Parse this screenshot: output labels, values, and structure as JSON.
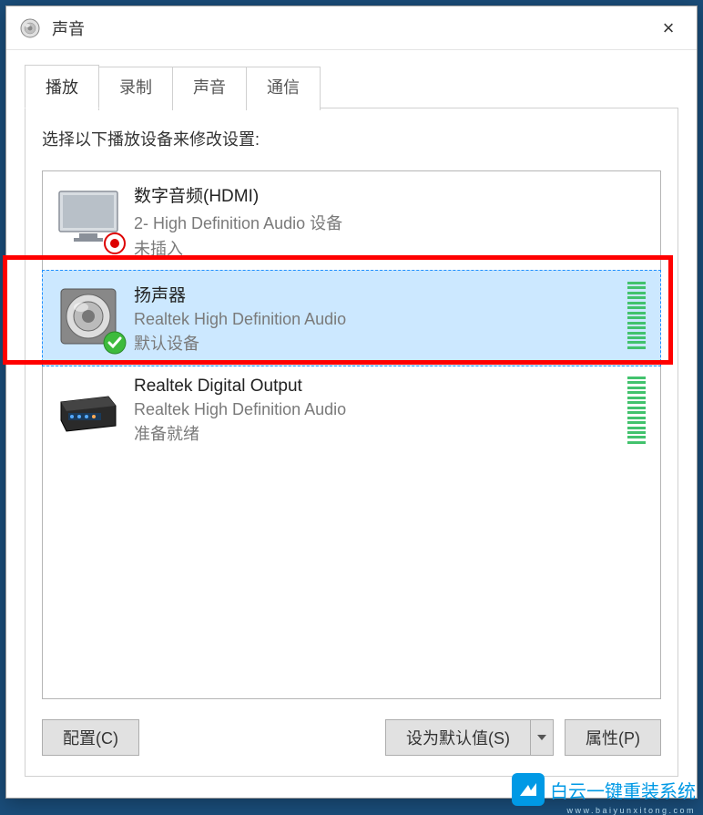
{
  "window": {
    "title": "声音",
    "close_label": "×"
  },
  "tabs": [
    {
      "label": "播放",
      "active": true
    },
    {
      "label": "录制",
      "active": false
    },
    {
      "label": "声音",
      "active": false
    },
    {
      "label": "通信",
      "active": false
    }
  ],
  "instruction": "选择以下播放设备来修改设置:",
  "devices": [
    {
      "name": "数字音频(HDMI)",
      "description": "2- High Definition Audio 设备",
      "status": "未插入",
      "icon": "monitor",
      "badge": "error",
      "selected": false,
      "meter": false
    },
    {
      "name": "扬声器",
      "description": "Realtek High Definition Audio",
      "status": "默认设备",
      "icon": "speaker",
      "badge": "check",
      "selected": true,
      "meter": true,
      "meter_active": true
    },
    {
      "name": "Realtek Digital Output",
      "description": "Realtek High Definition Audio",
      "status": "准备就绪",
      "icon": "digital",
      "badge": null,
      "selected": false,
      "meter": true,
      "meter_active": true
    }
  ],
  "buttons": {
    "configure": "配置(C)",
    "set_default": "设为默认值(S)",
    "properties": "属性(P)"
  },
  "watermark": {
    "text": "白云一键重装系统",
    "url": "www.baiyunxitong.com"
  }
}
